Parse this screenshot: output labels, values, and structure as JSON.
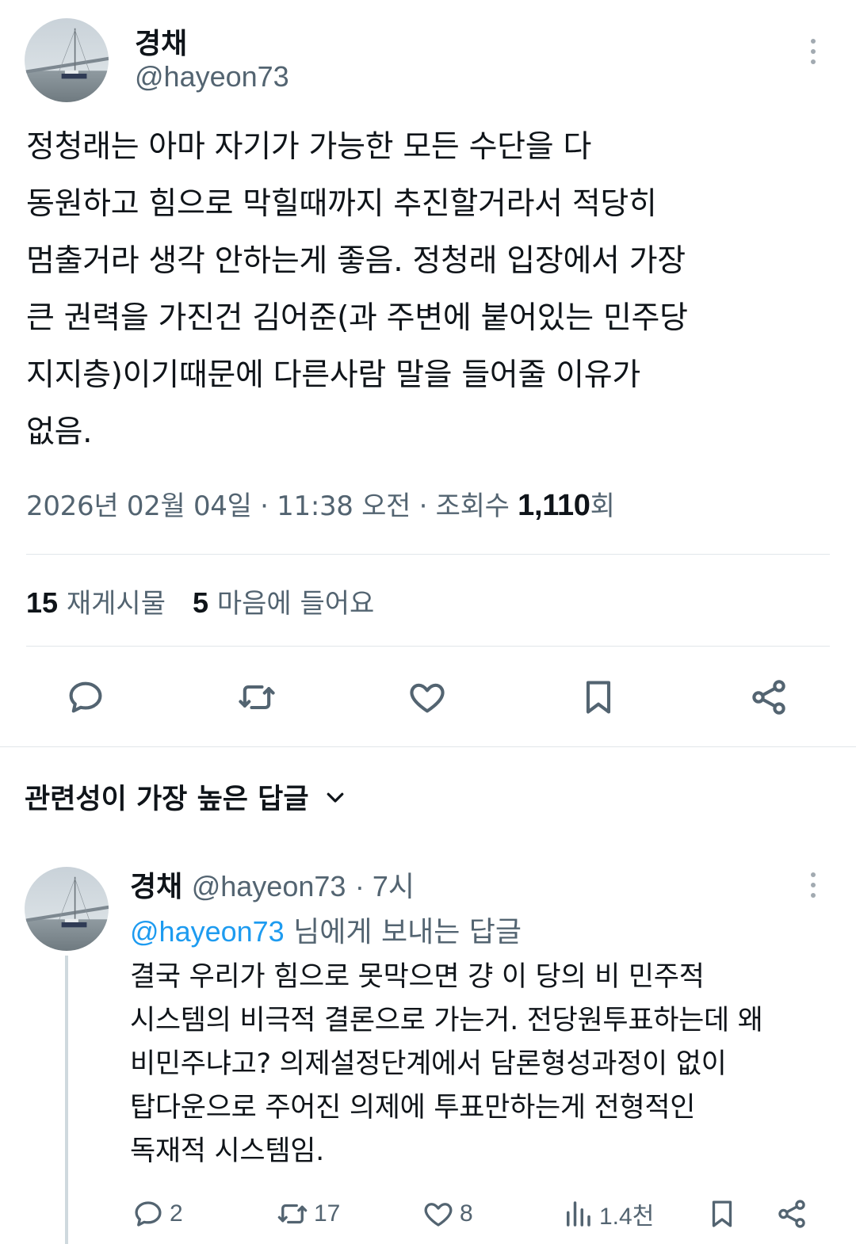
{
  "tweet": {
    "author_name": "경채",
    "author_handle": "@hayeon73",
    "text": "정청래는 아마 자기가 가능한 모든 수단을 다\n동원하고 힘으로 막힐때까지 추진할거라서 적당히\n멈출거라 생각 안하는게 좋음. 정청래 입장에서 가장\n큰 권력을 가진건 김어준(과 주변에 붙어있는 민주당\n지지층)이기때문에 다른사람 말을 들어줄 이유가\n없음.",
    "date": "2026년 02월 04일",
    "time": "11:38 오전",
    "views_label": "조회수",
    "views_count": "1,110",
    "views_suffix": "회",
    "reposts_count": "15",
    "reposts_label": "재게시물",
    "likes_count": "5",
    "likes_label": "마음에 들어요"
  },
  "replies_header": "관련성이 가장 높은 답글",
  "reply": {
    "author_name": "경채",
    "author_handle": "@hayeon73",
    "time": "7시",
    "reply_to_mention": "@hayeon73",
    "reply_to_suffix": "님에게 보내는 답글",
    "text": "결국 우리가 힘으로 못막으면 걍 이 당의 비 민주적\n시스템의 비극적 결론으로 가는거. 전당원투표하는데 왜\n비민주냐고? 의제설정단계에서 담론형성과정이 없이\n탑다운으로 주어진 의제에 투표만하는게 전형적인\n독재적 시스템임.",
    "reply_count": "2",
    "repost_count": "17",
    "like_count": "8",
    "views_count": "1.4천"
  },
  "icons": {
    "reply": "reply-icon",
    "repost": "repost-icon",
    "like": "heart-icon",
    "bookmark": "bookmark-icon",
    "share": "share-icon",
    "views": "views-icon",
    "more": "more-icon",
    "chevron": "chevron-down-icon"
  },
  "colors": {
    "text": "#0f1419",
    "secondary": "#536471",
    "mention": "#1d9bf0",
    "divider": "#e1e6ea"
  }
}
